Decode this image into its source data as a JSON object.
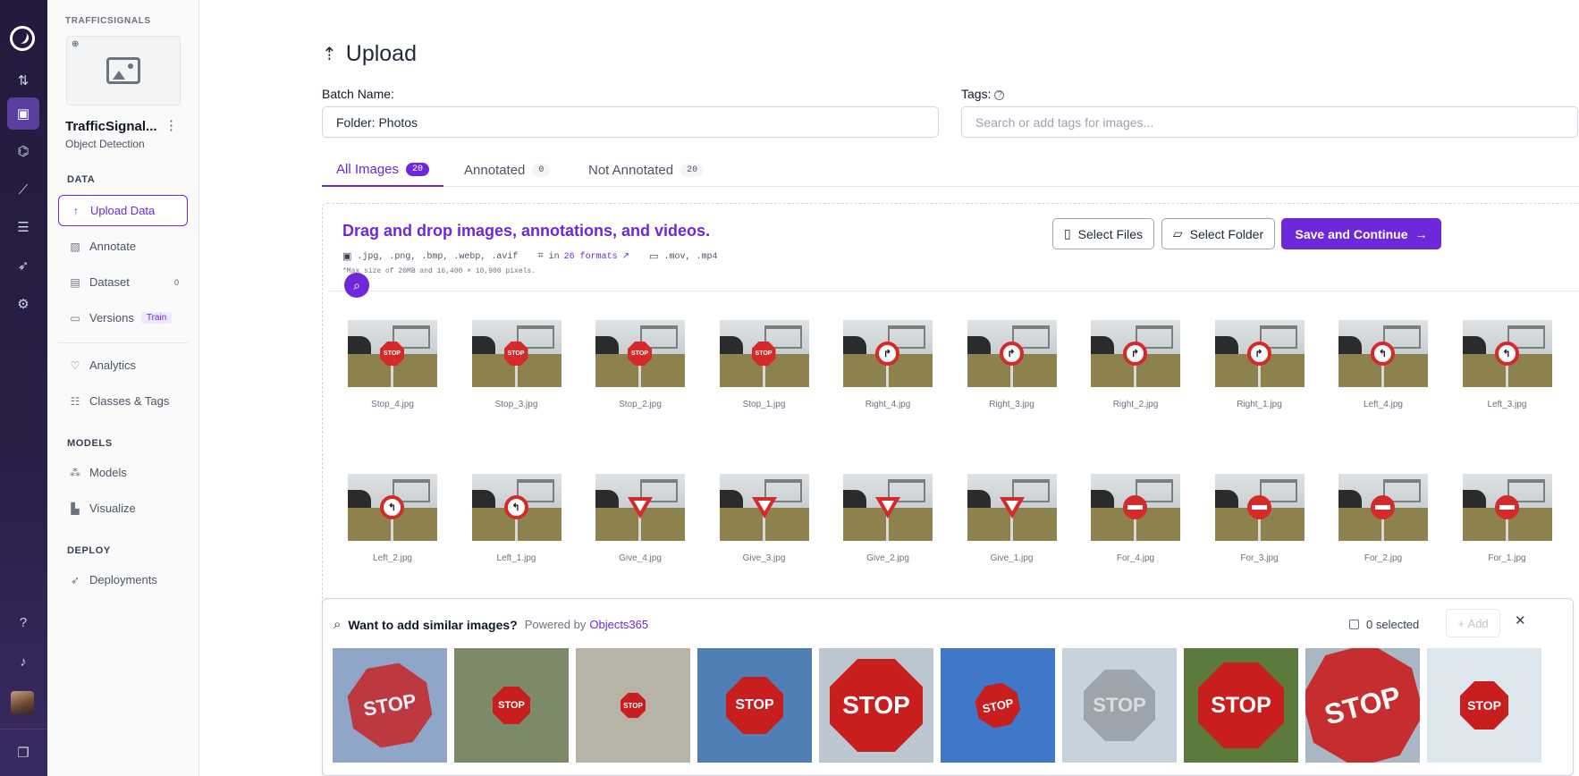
{
  "workspace": "TRAFFICSIGNALS",
  "project": {
    "name": "TrafficSignal...",
    "type": "Object Detection"
  },
  "sidebar": {
    "data_heading": "DATA",
    "models_heading": "MODELS",
    "deploy_heading": "DEPLOY",
    "upload": "Upload Data",
    "annotate": "Annotate",
    "dataset": "Dataset",
    "dataset_count": "0",
    "versions": "Versions",
    "versions_badge": "Train",
    "analytics": "Analytics",
    "classes": "Classes & Tags",
    "models": "Models",
    "visualize": "Visualize",
    "deployments": "Deployments"
  },
  "page": {
    "title": "Upload"
  },
  "form": {
    "batch_label": "Batch Name:",
    "batch_value": "Folder: Photos",
    "tags_label": "Tags:",
    "tags_placeholder": "Search or add tags for images..."
  },
  "tabs": [
    {
      "label": "All Images",
      "count": "20"
    },
    {
      "label": "Annotated",
      "count": "0"
    },
    {
      "label": "Not Annotated",
      "count": "20"
    }
  ],
  "dropzone": {
    "title": "Drag and drop images, annotations, and videos.",
    "image_formats": ".jpg, .png, .bmp, .webp, .avif",
    "annotation_prefix": "in",
    "annotation_link": "26 formats",
    "video_formats": ".mov, .mp4",
    "max_size": "*Max size of 20MB and 16,400 × 10,900 pixels."
  },
  "buttons": {
    "select_files": "Select Files",
    "select_folder": "Select Folder",
    "save_continue": "Save and Continue"
  },
  "images": [
    {
      "name": "Stop_4.jpg",
      "sign": "stop"
    },
    {
      "name": "Stop_3.jpg",
      "sign": "stop"
    },
    {
      "name": "Stop_2.jpg",
      "sign": "stop"
    },
    {
      "name": "Stop_1.jpg",
      "sign": "stop"
    },
    {
      "name": "Right_4.jpg",
      "sign": "right"
    },
    {
      "name": "Right_3.jpg",
      "sign": "right"
    },
    {
      "name": "Right_2.jpg",
      "sign": "right"
    },
    {
      "name": "Right_1.jpg",
      "sign": "right"
    },
    {
      "name": "Left_4.jpg",
      "sign": "left"
    },
    {
      "name": "Left_3.jpg",
      "sign": "left"
    },
    {
      "name": "Left_2.jpg",
      "sign": "left"
    },
    {
      "name": "Left_1.jpg",
      "sign": "left"
    },
    {
      "name": "Give_4.jpg",
      "sign": "give"
    },
    {
      "name": "Give_3.jpg",
      "sign": "give"
    },
    {
      "name": "Give_2.jpg",
      "sign": "give"
    },
    {
      "name": "Give_1.jpg",
      "sign": "give"
    },
    {
      "name": "For_4.jpg",
      "sign": "noentry"
    },
    {
      "name": "For_3.jpg",
      "sign": "noentry"
    },
    {
      "name": "For_2.jpg",
      "sign": "noentry"
    },
    {
      "name": "For_1.jpg",
      "sign": "noentry"
    }
  ],
  "similar": {
    "title": "Want to add similar images?",
    "powered_by": "Powered by",
    "brand": "Objects365",
    "selected": "0 selected",
    "add": "Add",
    "sign_text": "STOP",
    "photos": [
      {
        "bg": "#8fa6c9"
      },
      {
        "bg": "#7c8a6a"
      },
      {
        "bg": "#b7b3a6"
      },
      {
        "bg": "#4f7fb5"
      },
      {
        "bg": "#bcc6d1"
      },
      {
        "bg": "#3f78c9"
      },
      {
        "bg": "#c7d3dc"
      },
      {
        "bg": "#5b7a3c"
      },
      {
        "bg": "#a9b7c4"
      },
      {
        "bg": "#dfe7ee"
      }
    ]
  },
  "colors": {
    "accent": "#6d28d9",
    "rail": "#241a3d",
    "sign_red": "#d42a2a"
  }
}
